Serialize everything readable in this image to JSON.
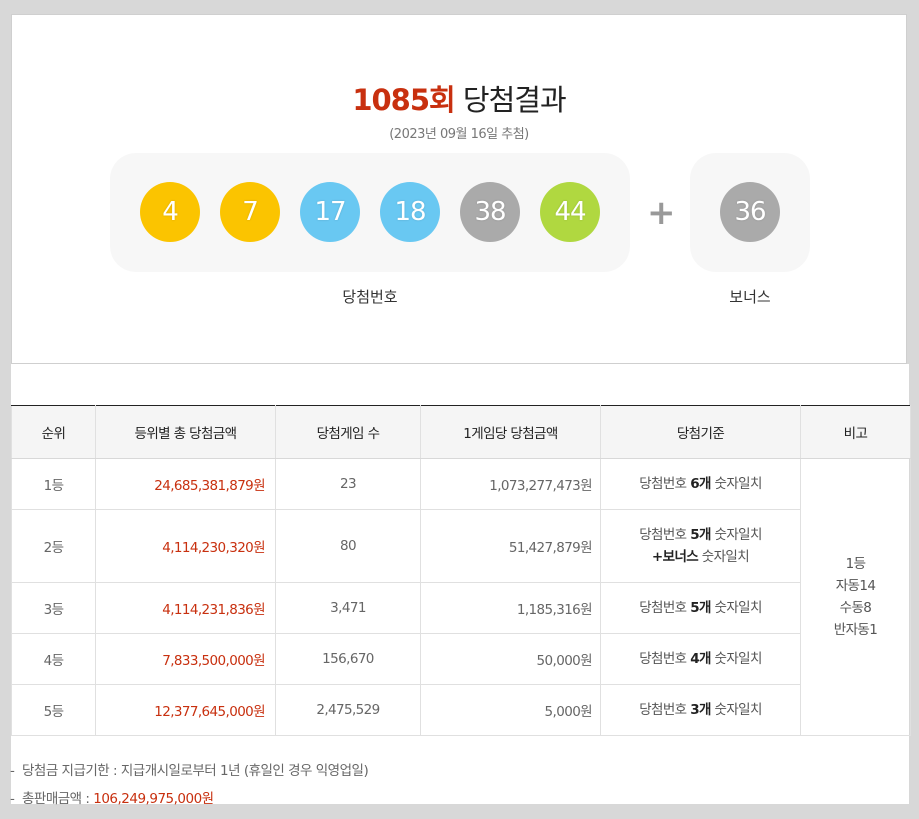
{
  "header": {
    "round": "1085회",
    "title_suffix": " 당첨결과",
    "subtitle": "(2023년 09월 16일 추첨)"
  },
  "numbers": {
    "winning": [
      {
        "value": "4",
        "color": "#fbc400"
      },
      {
        "value": "7",
        "color": "#fbc400"
      },
      {
        "value": "17",
        "color": "#69c8f2"
      },
      {
        "value": "18",
        "color": "#69c8f2"
      },
      {
        "value": "38",
        "color": "#aaaaaa"
      },
      {
        "value": "44",
        "color": "#b0d840"
      }
    ],
    "plus_symbol": "+",
    "bonus": {
      "value": "36",
      "color": "#aaaaaa"
    },
    "winning_label": "당첨번호",
    "bonus_label": "보너스"
  },
  "table": {
    "headers": [
      "순위",
      "등위별 총 당첨금액",
      "당첨게임 수",
      "1게임당 당첨금액",
      "당첨기준",
      "비고"
    ],
    "rows": [
      {
        "rank": "1등",
        "total": "24,685,381,879원",
        "games": "23",
        "per_game": "1,073,277,473원",
        "crit_pre": "당첨번호 ",
        "crit_bold": "6개",
        "crit_post": " 숫자일치"
      },
      {
        "rank": "2등",
        "total": "4,114,230,320원",
        "games": "80",
        "per_game": "51,427,879원",
        "crit_pre": "당첨번호 ",
        "crit_bold": "5개",
        "crit_post": " 숫자일치",
        "crit2_bold": "+보너스",
        "crit2_post": " 숫자일치"
      },
      {
        "rank": "3등",
        "total": "4,114,231,836원",
        "games": "3,471",
        "per_game": "1,185,316원",
        "crit_pre": "당첨번호 ",
        "crit_bold": "5개",
        "crit_post": " 숫자일치"
      },
      {
        "rank": "4등",
        "total": "7,833,500,000원",
        "games": "156,670",
        "per_game": "50,000원",
        "crit_pre": "당첨번호 ",
        "crit_bold": "4개",
        "crit_post": " 숫자일치"
      },
      {
        "rank": "5등",
        "total": "12,377,645,000원",
        "games": "2,475,529",
        "per_game": "5,000원",
        "crit_pre": "당첨번호 ",
        "crit_bold": "3개",
        "crit_post": " 숫자일치"
      }
    ],
    "note": [
      "1등",
      "자동14",
      "수동8",
      "반자동1"
    ]
  },
  "footnotes": {
    "deadline": "당첨금 지급기한 : 지급개시일로부터 1년 (휴일인 경우 익영업일)",
    "total_sales_label": "총판매금액 : ",
    "total_sales_value": "106,249,975,000원"
  },
  "colors": {
    "accent_red": "#c8300f",
    "ball_yellow": "#fbc400",
    "ball_blue": "#69c8f2",
    "ball_gray": "#aaaaaa",
    "ball_green": "#b0d840"
  }
}
